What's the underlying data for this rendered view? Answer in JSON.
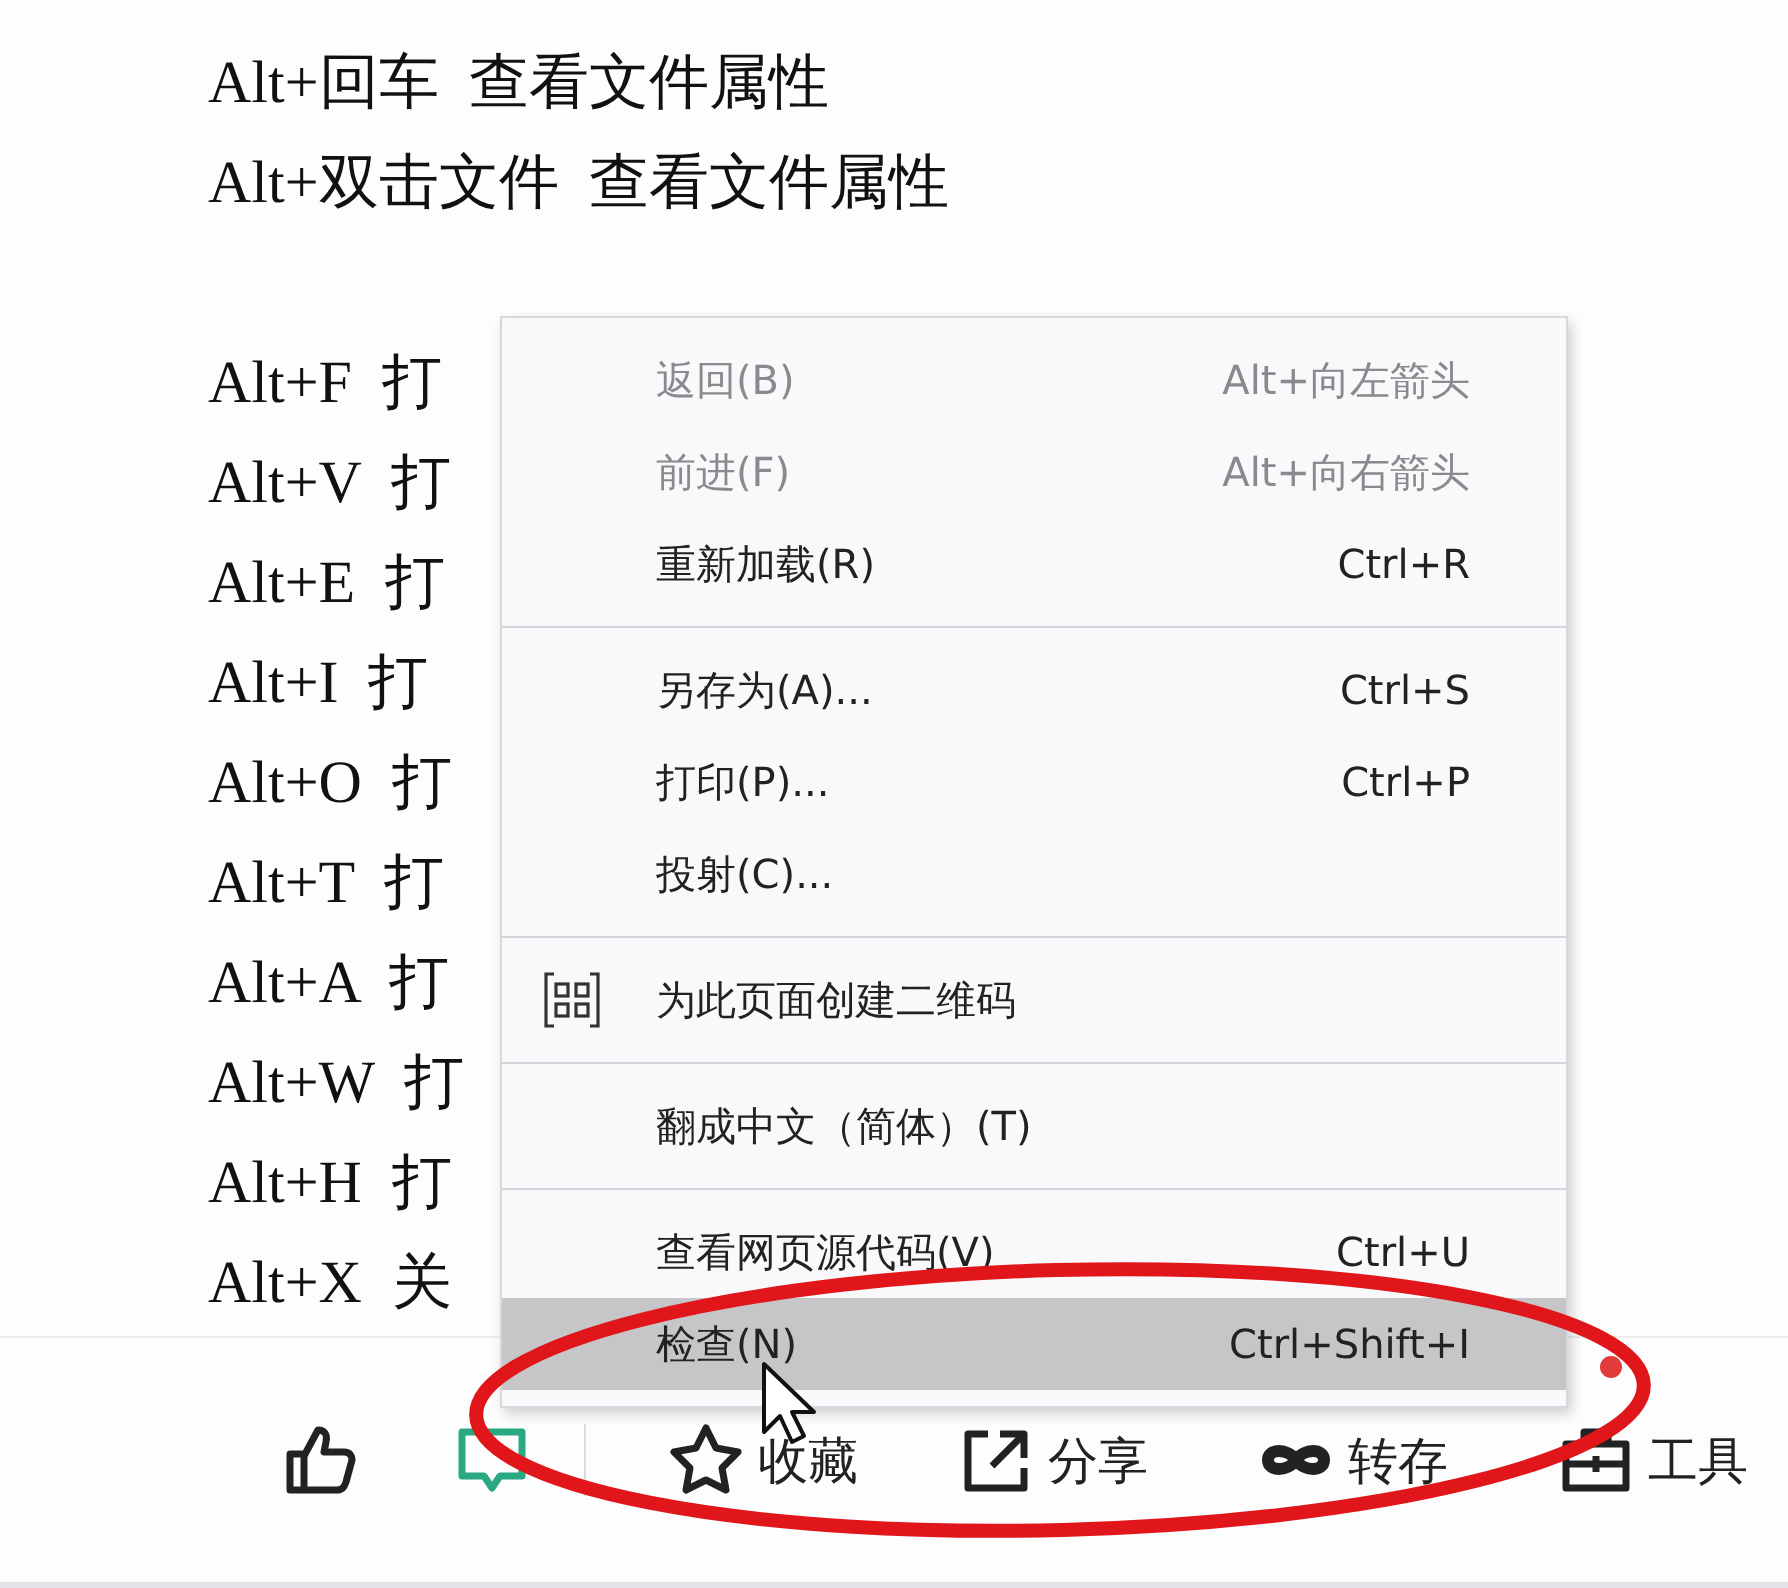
{
  "document": {
    "paragraphs": [
      [
        "Alt+回车  查看文件属性",
        "Alt+双击文件  查看文件属性"
      ],
      [
        "Alt+F  打",
        "Alt+V  打",
        "Alt+E  打",
        "Alt+I  打",
        "Alt+O  打",
        "Alt+T  打",
        "Alt+A  打",
        "Alt+W  打",
        "Alt+H  打",
        "Alt+X  关"
      ]
    ]
  },
  "context_menu": {
    "groups": [
      [
        {
          "label": "返回(B)",
          "shortcut": "Alt+向左箭头",
          "disabled": true,
          "selected": false
        },
        {
          "label": "前进(F)",
          "shortcut": "Alt+向右箭头",
          "disabled": true,
          "selected": false
        },
        {
          "label": "重新加载(R)",
          "shortcut": "Ctrl+R",
          "disabled": false,
          "selected": false
        }
      ],
      [
        {
          "label": "另存为(A)...",
          "shortcut": "Ctrl+S",
          "disabled": false,
          "selected": false
        },
        {
          "label": "打印(P)...",
          "shortcut": "Ctrl+P",
          "disabled": false,
          "selected": false
        },
        {
          "label": "投射(C)...",
          "disabled": false,
          "selected": false
        }
      ],
      [
        {
          "label": "为此页面创建二维码",
          "kind": "qr",
          "disabled": false,
          "selected": false
        }
      ],
      [
        {
          "label": "翻成中文（简体）(T)",
          "disabled": false,
          "selected": false
        }
      ],
      [
        {
          "label": "查看网页源代码(V)",
          "shortcut": "Ctrl+U",
          "disabled": false,
          "selected": false
        },
        {
          "label": "检查(N)",
          "shortcut": "Ctrl+Shift+I",
          "disabled": false,
          "selected": true
        }
      ]
    ]
  },
  "toolbar": {
    "items": [
      {
        "kind": "like"
      },
      {
        "kind": "comment"
      },
      {
        "kind": "collect",
        "label": "收藏"
      },
      {
        "kind": "share",
        "label": "分享"
      },
      {
        "kind": "save",
        "label": "转存"
      },
      {
        "kind": "tools",
        "label": "工具"
      }
    ]
  }
}
